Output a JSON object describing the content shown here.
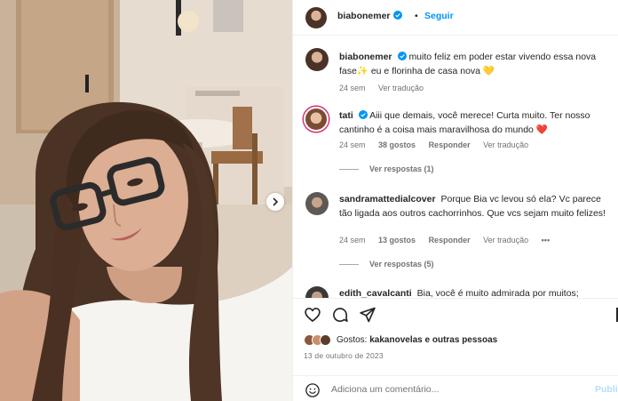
{
  "post": {
    "author": "biabonemer",
    "follow_label": "Seguir",
    "caption": {
      "username": "biabonemer",
      "text": "muito feliz em poder estar vivendo essa nova fase✨ eu e florinha de casa nova 💛",
      "time": "24 sem",
      "translate": "Ver tradução"
    }
  },
  "comments": [
    {
      "username": "tati",
      "verified": true,
      "text": "Aiii que demais, você merece! Curta muito. Ter nosso cantinho é a coisa mais maravilhosa do mundo ❤️",
      "time": "24 sem",
      "likes": "38 gostos",
      "reply": "Responder",
      "translate": "Ver tradução",
      "replies": "Ver respostas (1)"
    },
    {
      "username": "sandramattedialcover",
      "verified": false,
      "text": "Porque Bia vc levou só ela? Vc parece tão ligada aos outros cachorrinhos. Que vcs sejam muito felizes!",
      "time": "24 sem",
      "likes": "13 gostos",
      "reply": "Responder",
      "translate": "Ver tradução",
      "more": "•••",
      "replies": "Ver respostas (5)"
    },
    {
      "username": "edith_cavalcanti",
      "verified": false,
      "text": "Bia, você é muito admirada por muitos;"
    }
  ],
  "likes": {
    "prefix": "Gostos: ",
    "text": "kakanovelas e outras pessoas"
  },
  "date": "13 de outubro de 2023",
  "add_comment": {
    "placeholder": "Adiciona um comentário...",
    "post_label": "Publicar"
  },
  "colors": {
    "accent": "#0095f6",
    "heart": "#ed4956",
    "muted": "#737373"
  }
}
